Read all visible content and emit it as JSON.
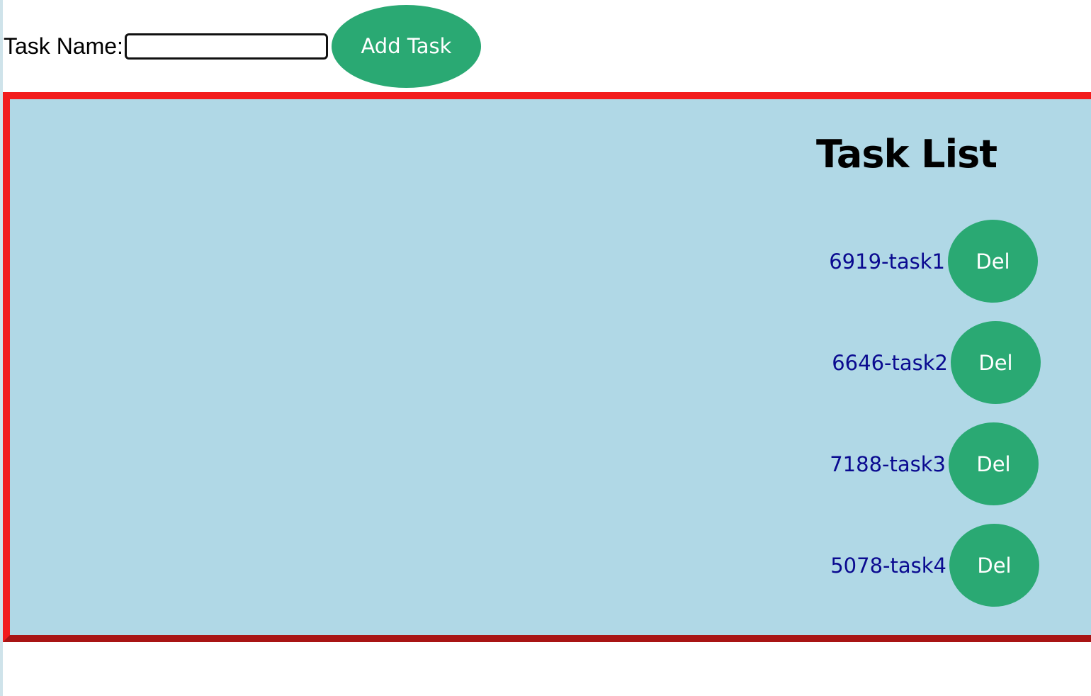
{
  "form": {
    "label": "Task Name:",
    "input_value": "",
    "add_button_label": "Add Task"
  },
  "task_list": {
    "title": "Task List",
    "items": [
      {
        "label": "6919-task1",
        "del_label": "Del"
      },
      {
        "label": "6646-task2",
        "del_label": "Del"
      },
      {
        "label": "7188-task3",
        "del_label": "Del"
      },
      {
        "label": "5078-task4",
        "del_label": "Del"
      }
    ]
  },
  "colors": {
    "button_bg": "#2aa973",
    "panel_bg": "#b0d8e6",
    "panel_border": "#f21c1c",
    "panel_border_bottom": "#a81414",
    "task_text": "#0a0a90"
  }
}
